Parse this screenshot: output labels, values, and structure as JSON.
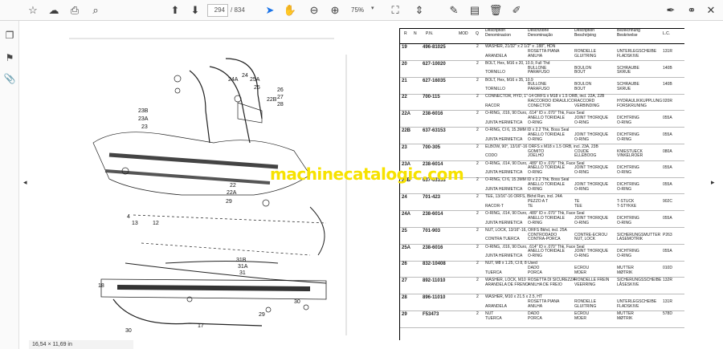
{
  "toolbar": {
    "page_current": "294",
    "page_total": "/ 834",
    "zoom": "75%",
    "icons": [
      "star-icon",
      "cloud-upload-icon",
      "print-icon",
      "search-icon",
      "page-up-icon",
      "page-down-icon",
      "select-cursor-icon",
      "hand-icon",
      "zoom-out-icon",
      "zoom-in-icon",
      "fit-page-icon",
      "scroll-icon",
      "comment-icon",
      "highlight-icon",
      "delete-icon",
      "draw-icon",
      "pen-sign-icon",
      "link-icon",
      "close-icon"
    ]
  },
  "sidebar": {
    "icons": [
      "pages-icon",
      "bookmark-icon",
      "attachment-icon"
    ]
  },
  "status": {
    "page_size": "16,54 × 11,69 in"
  },
  "watermark": "machinecatalogic.com",
  "diagram": {
    "callouts": [
      "24",
      "24A",
      "25A",
      "25",
      "22B",
      "23B",
      "23A",
      "23",
      "26",
      "27",
      "28",
      "22",
      "22A",
      "29",
      "4",
      "13",
      "12",
      "31B",
      "31A",
      "31",
      "18",
      "30",
      "17",
      "29",
      "30",
      "30"
    ]
  },
  "table": {
    "headers": {
      "r": "R",
      "n": "N",
      "pn": "P.N.",
      "mod": "MOD",
      "q": "Q",
      "d1": [
        "Description",
        "Denominacion"
      ],
      "d2": [
        "Descrizione",
        "Denominação"
      ],
      "d3": [
        "Description",
        "Beschrijving"
      ],
      "d4": [
        "Bezeichnung",
        "Beskrivelse"
      ],
      "lc": "L.C."
    },
    "rows": [
      {
        "ref": "19",
        "pn": "496-81025",
        "qty": "2",
        "lines": [
          [
            "WASHER, 21/32\" x 2 1/2\" x .188\", HDN",
            "",
            ""
          ],
          [
            "",
            "ROSETTA PIANA",
            "RONDELLE",
            "UNTERLEGSCHEIBE",
            "131R"
          ],
          [
            "ARANDELA",
            "ANILHA",
            "GLUITRING",
            "FLADSKIVE",
            ""
          ]
        ]
      },
      {
        "ref": "20",
        "pn": "627-10020",
        "qty": "2",
        "lines": [
          [
            "BOLT, Hex, M16 x 20, 10.9, Full Thd",
            "",
            ""
          ],
          [
            "",
            "BULLONE",
            "BOULON",
            "SCHRAUBE",
            "140B"
          ],
          [
            "TORNILLO",
            "PARAFUSO",
            "BOUT",
            "SKRUE",
            ""
          ]
        ]
      },
      {
        "ref": "21",
        "pn": "627-16035",
        "qty": "2",
        "lines": [
          [
            "BOLT, Hex, M16 x 35, 10.9",
            "",
            ""
          ],
          [
            "",
            "BULLONE",
            "BOULON",
            "SCHRAUBE",
            "140B"
          ],
          [
            "TORNILLO",
            "PARAFUSO",
            "BOUT",
            "SKRUE",
            ""
          ]
        ]
      },
      {
        "ref": "22",
        "pn": "700-115",
        "qty": "2",
        "lines": [
          [
            "CONNECTOR, HYD, 1\"-14 ORFS x M18 x 1.5 ORB, incl. 22A, 22B",
            "",
            ""
          ],
          [
            "",
            "RACCORDO IDRAULICO",
            "RACCORD",
            "HYDRAULIKKUPPLUNG",
            "020R"
          ],
          [
            "RACOR",
            "CONECTOR",
            "VERBINDING",
            "FORSKRUNING",
            ""
          ]
        ]
      },
      {
        "ref": "22A",
        "pn": "238-6016",
        "qty": "2",
        "lines": [
          [
            "O-RING, .016, 90 Duro, .614\" ID x .070\" Thk, Face Seal",
            "",
            ""
          ],
          [
            "",
            "ANELLO TORIDALE",
            "JOINT THORIQUE",
            "DICHTRING",
            "055A"
          ],
          [
            "JUNTA HERMETICA",
            "O-RING",
            "O-RING",
            "O-RING",
            ""
          ]
        ]
      },
      {
        "ref": "22B",
        "pn": "637-63153",
        "qty": "2",
        "lines": [
          [
            "O-RING, CI 6, 15.3MM ID x 2.2 Thk, Boss Seal",
            "",
            ""
          ],
          [
            "",
            "ANELLO TORIDALE",
            "JOINT THORIQUE",
            "DICHTRING",
            "055A"
          ],
          [
            "JUNTA HERMETICA",
            "O-RING",
            "O-RING",
            "O-RING",
            ""
          ]
        ]
      },
      {
        "ref": "23",
        "pn": "700-305",
        "qty": "2",
        "lines": [
          [
            "ELBOW, 90°, 13/16\"-16 ORFS x M18 x 1.5 ORB, incl. 23A, 23B",
            "",
            ""
          ],
          [
            "",
            "GOMITO",
            "COUDE",
            "KNIESTUECK",
            "080A"
          ],
          [
            "CODO",
            "JOELHO",
            "ELLEBOOG",
            "VINKELROER",
            ""
          ]
        ]
      },
      {
        "ref": "23A",
        "pn": "238-6014",
        "qty": "2",
        "lines": [
          [
            "O-RING, .014, 90 Duro, .489\" ID x .070\" Thk, Face Seal",
            "",
            ""
          ],
          [
            "",
            "ANELLO TORIDALE",
            "JOINT THORIQUE",
            "DICHTRING",
            "055A"
          ],
          [
            "JUNTA HERMETICA",
            "O-RING",
            "O-RING",
            "O-RING",
            ""
          ]
        ]
      },
      {
        "ref": "23B",
        "pn": "637-63153",
        "qty": "2",
        "lines": [
          [
            "O-RING, CI 6, 15.3MM ID x 2.2 Thk, Boss Seal",
            "",
            ""
          ],
          [
            "",
            "ANELLO TORIDALE",
            "JOINT THORIQUE",
            "DICHTRING",
            "055A"
          ],
          [
            "JUNTA HERMETICA",
            "O-RING",
            "O-RING",
            "O-RING",
            ""
          ]
        ]
      },
      {
        "ref": "24",
        "pn": "701-423",
        "qty": "2",
        "lines": [
          [
            "TEE, 13/16\"-16 ORFS, Bkhd Run, incl. 24A",
            "",
            ""
          ],
          [
            "",
            "PEZZO A T",
            "TE",
            "T-STUCK",
            "902C"
          ],
          [
            "RACOR-T",
            "TE",
            "TEE",
            "T-STYKKE",
            ""
          ]
        ]
      },
      {
        "ref": "24A",
        "pn": "238-6014",
        "qty": "2",
        "lines": [
          [
            "O-RING, .014, 90 Duro, .489\" ID x .070\" Thk, Face Seal",
            "",
            ""
          ],
          [
            "",
            "ANELLO TORIDALE",
            "JOINT THORIQUE",
            "DICHTRING",
            "055A"
          ],
          [
            "JUNTA HERMETICA",
            "O-RING",
            "O-RING",
            "O-RING",
            ""
          ]
        ]
      },
      {
        "ref": "25",
        "pn": "701-903",
        "qty": "2",
        "lines": [
          [
            "NUT, LOCK, 13/16\"-16, ORFS Bkhd, incl. 25A",
            "",
            ""
          ],
          [
            "",
            "CONTRODADO",
            "CONTRE-ECROU",
            "SICHERUNGSMUTTER",
            "P263"
          ],
          [
            "CONTRA TUERCA",
            "CONTRA-PORCA",
            "NUT, LOCK",
            "LASEMOTRIK",
            ""
          ]
        ]
      },
      {
        "ref": "25A",
        "pn": "238-6016",
        "qty": "2",
        "lines": [
          [
            "O-RING, .016, 90 Duro, .614\" ID x .070\" Thk, Face Seal",
            "",
            ""
          ],
          [
            "",
            "ANELLO TORIDALE",
            "JOINT THORIQUE",
            "DICHTRING",
            "055A"
          ],
          [
            "JUNTA HERMETICA",
            "O-RING",
            "O-RING",
            "O-RING",
            ""
          ]
        ]
      },
      {
        "ref": "26",
        "pn": "832-10408",
        "qty": "2",
        "lines": [
          [
            "NUT, M8 x 1.25, Cl 8, 8 Used",
            "",
            ""
          ],
          [
            "",
            "DADO",
            "ECROU",
            "MUTTER",
            "010D"
          ],
          [
            "TUERCA",
            "PORCA",
            "MOER",
            "MØTRIK",
            ""
          ]
        ]
      },
      {
        "ref": "27",
        "pn": "892-11010",
        "qty": "2",
        "lines": [
          [
            "WASHER, LOCK, M10",
            "ROSETTA DI SICUREZZA",
            "RONDELLE FREIN",
            "SICHERUNGSSCHEIBE",
            "132R"
          ],
          [
            "ARANDELA DE FRENO",
            "ANILHA DE FREIO",
            "VEERRING",
            "LÅSESKIVE",
            ""
          ],
          [
            "",
            "",
            "",
            "",
            ""
          ]
        ]
      },
      {
        "ref": "28",
        "pn": "896-11010",
        "qty": "2",
        "lines": [
          [
            "WASHER, M10 x 21.5 x 2.5, HT",
            "",
            ""
          ],
          [
            "",
            "ROSETTA PIANA",
            "RONDELLE",
            "UNTERLEGSCHEIBE",
            "131R"
          ],
          [
            "ARANDELA",
            "ANILHA",
            "GLUITRING",
            "FLADSKIVE",
            ""
          ]
        ]
      },
      {
        "ref": "29",
        "pn": "F53473",
        "qty": "2",
        "lines": [
          [
            "NUT",
            "DADO",
            "ECROU",
            "MUTTER",
            "578D"
          ],
          [
            "TUERCA",
            "PORCA",
            "MOER",
            "MØTRIK",
            ""
          ],
          [
            "",
            "",
            "",
            "",
            ""
          ]
        ]
      }
    ]
  }
}
